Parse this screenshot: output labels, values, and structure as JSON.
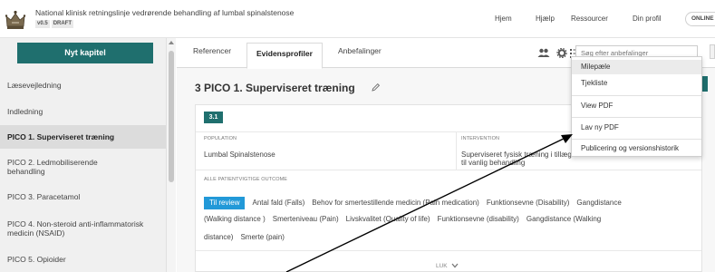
{
  "header": {
    "title": "National klinisk retningslinje vedrørende behandling af lumbal spinalstenose",
    "version_badge": "v0.5",
    "status_badge": "DRAFT",
    "nav": [
      "Hjem",
      "Hjælp",
      "Ressourcer",
      "Din profil"
    ],
    "online": "ONLINE"
  },
  "sidebar": {
    "new_chapter": "Nyt kapitel",
    "items": [
      "Læsevejledning",
      "Indledning",
      "PICO 1. Superviseret træning",
      "PICO 2. Ledmobiliserende behandling",
      "PICO 3. Paracetamol",
      "PICO 4. Non-steroid anti-inflammatorisk medicin (NSAID)",
      "PICO 5. Opioider"
    ],
    "active_index": 2
  },
  "tabs": [
    "Referencer",
    "Evidensprofiler",
    "Anbefalinger"
  ],
  "search": {
    "placeholder": "Søg efter anbefalinger"
  },
  "pico": {
    "heading": "3  PICO 1. Superviseret træning",
    "sub_number": "3.1",
    "population_label": "POPULATION",
    "population": "Lumbal Spinalstenose",
    "intervention_label": "INTERVENTION",
    "intervention_line1": "Superviseret fysisk træning i tillæg",
    "intervention_line2": "til vanlig behandling",
    "outcomes_label": "ALLE PATIENTVIGTIGE OUTCOME",
    "review_button": "Til review",
    "outcomes_row1": [
      "Antal fald (Falls)",
      "Behov for smertestillende medicin (Pain medication)",
      "Funktionsevne (Disability)",
      "Gangdistance"
    ],
    "outcomes_row2": [
      "(Walking distance )",
      "Smerteniveau (Pain)",
      "Livskvalitet (Quality of life)",
      "Funktionsevne (disability)",
      "Gangdistance (Walking"
    ],
    "outcomes_row3": [
      "distance)",
      "Smerte (pain)"
    ],
    "close_label": "LUK"
  },
  "menu": {
    "items": [
      "Milepæle",
      "Tjekliste",
      "View PDF",
      "Lav ny PDF",
      "Publicering og versionshistorik"
    ],
    "highlighted_index": 0
  },
  "colors": {
    "teal": "#1f6f6e",
    "blue_pill": "#2299d8",
    "sidebar_bg": "#f0f0f0"
  },
  "icons": [
    "crown-logo-icon",
    "users-icon",
    "gear-icon",
    "list-icon",
    "pencil-icon",
    "chevron-down-icon",
    "scroll-up-icon"
  ]
}
